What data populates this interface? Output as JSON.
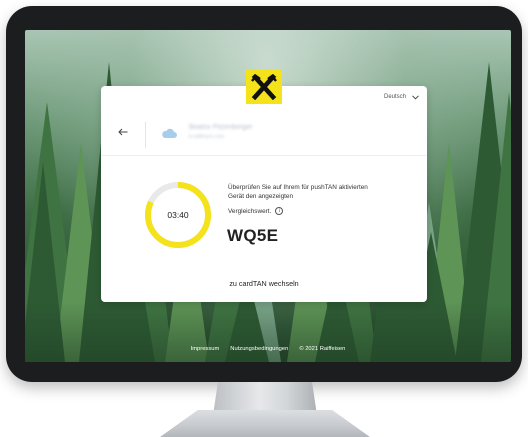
{
  "header": {
    "language": "Deutsch",
    "user_name": "Beatrix Pitzenberger",
    "user_sub": "b.raiffeisen.com"
  },
  "verification": {
    "timer": "03:40",
    "timer_progress_percent": 82,
    "instruction": "Überprüfen Sie auf Ihrem für pushTAN aktivierten Gerät den angezeigten",
    "compare_label": "Vergleichswert.",
    "code": "WQ5E"
  },
  "switch_link": "zu cardTAN wechseln",
  "footer": {
    "impressum": "Impressum",
    "terms": "Nutzungsbedingungen",
    "copyright": "© 2021 Raiffeisen"
  },
  "colors": {
    "accent": "#f4e21a",
    "logo_bg": "#f4e21a",
    "timer_track": "#e9e9e9",
    "monitor_frame": "#1b1d1f"
  },
  "icons": {
    "logo": "raiffeisen-gable-cross-icon",
    "back": "arrow-left-icon",
    "language_dropdown": "chevron-down-icon",
    "info": "info-icon",
    "avatar": "cloud-avatar-icon"
  }
}
